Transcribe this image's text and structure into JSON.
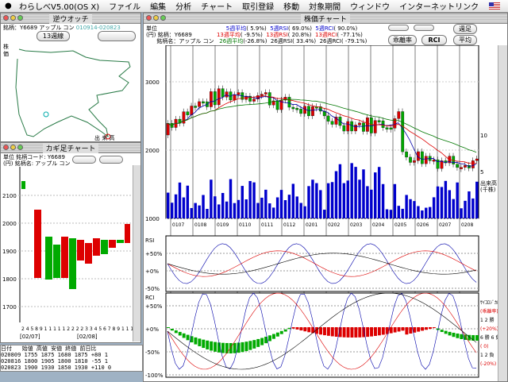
{
  "menubar": {
    "apple": "",
    "items": [
      "わらしべV5.00(OS X)",
      "ファイル",
      "編集",
      "分析",
      "チャート",
      "取引登録",
      "移動",
      "対象期間",
      "ウィンドウ",
      "インターネットリンク"
    ]
  },
  "gyaku": {
    "title": "逆ウオッチ",
    "code_label": "銘柄：",
    "code": "Y6689",
    "name": "アップル コン",
    "range": "010914-020823",
    "range_color": "#4aa",
    "period_btn": "13週線",
    "side_labels": [
      "株",
      "価"
    ],
    "bottom_label": "出 来 高"
  },
  "kagi": {
    "title": "カギ足チャート",
    "unit_label": "単位",
    "unit_val": "(円)",
    "code_label": "銘柄コード",
    "code": "Y6689",
    "name_label": "銘柄名",
    "name": "アップル コン",
    "y_ticks": [
      "2100",
      "2000",
      "1900",
      "1800",
      "1700"
    ],
    "x_labels": [
      "[02/07]",
      "[02/08]"
    ],
    "x_days": "2 4 5 8 9 1 1 1 1 1 2 2 2 2 3 3 4 5 6 7 8 9 1 1 1 1 1 1 2 2",
    "table": [
      [
        "020809",
        "1755",
        "1875",
        "1680",
        "1875",
        "+80",
        "1"
      ],
      [
        "020816",
        "1800",
        "1905",
        "1800",
        "1810",
        "-55",
        "1"
      ],
      [
        "020823",
        "1900",
        "1930",
        "1850",
        "1930",
        "+110",
        "0"
      ]
    ],
    "table_head": "日付   始値 高値 安値 終値 前日比 "
  },
  "kabuka": {
    "title": "株価チャート",
    "unit_label": "単位",
    "unit_val": "(円)",
    "code_label": "銘柄：",
    "code": "Y6689",
    "name_label": "銘柄名：",
    "name": "アップル コン",
    "ma": [
      {
        "label": "5週平均",
        "val": "( 5.9%)",
        "color": "#00a"
      },
      {
        "label": "13週平均",
        "val": "( -9.5%)",
        "color": "#d00"
      },
      {
        "label": "26週平均",
        "val": "(-26.8%)",
        "color": "#070"
      }
    ],
    "rsi": [
      {
        "label": "5週RSI",
        "val": "( 69.0%)",
        "color": "#00a"
      },
      {
        "label": "13週RSI",
        "val": "( 20.8%)",
        "color": "#d00"
      },
      {
        "label": "26週RSI",
        "val": "( 33.4%)",
        "color": "#000"
      }
    ],
    "rci": [
      {
        "label": "5週RCI",
        "val": "( 90.0%)",
        "color": "#00a"
      },
      {
        "label": "13週RCI",
        "val": "( -77.1%)",
        "color": "#d00"
      },
      {
        "label": "26週RCI",
        "val": "( -79.1%)",
        "color": "#000"
      }
    ],
    "buttons": {
      "kairi": "乖離率",
      "rci": "RCI",
      "shuu": "週足",
      "avg": "平均"
    },
    "price_ticks": [
      "3000",
      "2000",
      "1000"
    ],
    "vol_label": "出来高",
    "vol_unit": "(千株)",
    "vol_ticks": [
      "10",
      "5"
    ],
    "month_labels": [
      "0107",
      "0108",
      "0109",
      "0110",
      "0111",
      "0112",
      "0201",
      "0202",
      "0203",
      "0204",
      "0205",
      "0206",
      "0207",
      "0208"
    ],
    "rsi_label": "RSI",
    "rsi_ticks": [
      "+50%",
      "+0%",
      "-50%"
    ],
    "rci_label": "RCI",
    "rci_ticks": [
      "+50%",
      "+0%",
      "-50%",
      "-100%"
    ],
    "right_notes": [
      "ｻｲｺﾛｼﾞｶﾙ",
      "(乖離率)",
      "1 2 勝",
      "(+20%)",
      "6 勝 6 負",
      "( 0)",
      "1 2 負",
      "(-20%)"
    ]
  }
}
